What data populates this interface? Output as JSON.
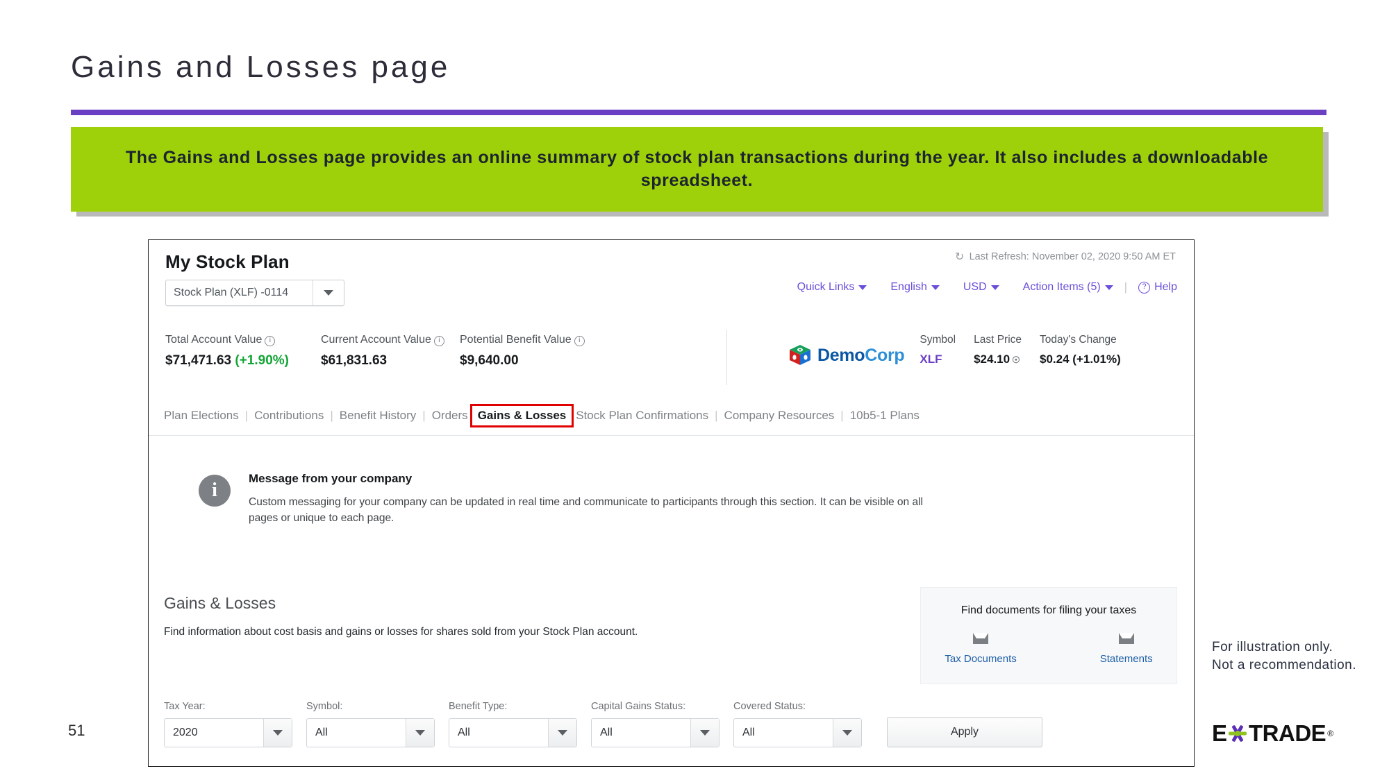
{
  "slide": {
    "title": "Gains and Losses page",
    "page_number": "51",
    "banner_text": "The Gains and Losses page provides an online summary of stock plan transactions during the year. It also includes a downloadable spreadsheet.",
    "footnote": "For illustration only. Not a recommendation.",
    "brand_logo": {
      "e": "E",
      "rest": "TRADE",
      "registered": "®"
    },
    "accent_purple": "#6b3fc4",
    "banner_green": "#9fd10a"
  },
  "app": {
    "title": "My Stock Plan",
    "account_select": {
      "value": "Stock Plan (XLF) -0114"
    },
    "last_refresh": "Last Refresh: November 02, 2020 9:50 AM ET",
    "utility_nav": [
      {
        "label": "Quick Links",
        "has_caret": true
      },
      {
        "label": "English",
        "has_caret": true
      },
      {
        "label": "USD",
        "has_caret": true
      },
      {
        "label": "Action Items (5)",
        "has_caret": true
      },
      {
        "label": "Help",
        "has_caret": false
      }
    ],
    "values": [
      {
        "label": "Total Account Value",
        "amount": "$71,471.63",
        "change": "(+1.90%)"
      },
      {
        "label": "Current Account Value",
        "amount": "$61,831.63",
        "change": ""
      },
      {
        "label": "Potential Benefit Value",
        "amount": "$9,640.00",
        "change": ""
      }
    ],
    "quote": {
      "company": "DemoCorp",
      "company_part1": "Demo",
      "company_part2": "Corp",
      "columns": [
        {
          "header": "Symbol",
          "value": "XLF"
        },
        {
          "header": "Last Price",
          "value": "$24.10"
        },
        {
          "header": "Today's Change",
          "value": "$0.24 (+1.01%)"
        }
      ]
    },
    "tabs": [
      {
        "label": "Plan Elections",
        "selected": false
      },
      {
        "label": "Contributions",
        "selected": false
      },
      {
        "label": "Benefit History",
        "selected": false
      },
      {
        "label": "Orders",
        "selected": false
      },
      {
        "label": "Gains & Losses",
        "selected": true
      },
      {
        "label": "Stock Plan Confirmations",
        "selected": false
      },
      {
        "label": "Company Resources",
        "selected": false
      },
      {
        "label": "10b5-1 Plans",
        "selected": false
      }
    ],
    "message": {
      "title": "Message from your company",
      "body": "Custom messaging for your company can be updated in real time and communicate to participants through this section. It can be visible on all pages or unique to each page."
    },
    "section": {
      "heading": "Gains & Losses",
      "description": "Find information about cost basis and gains or losses for shares sold from your Stock Plan account."
    },
    "tax_card": {
      "title": "Find documents for filing your taxes",
      "links": [
        {
          "label": "Tax Documents",
          "icon": "tray-icon"
        },
        {
          "label": "Statements",
          "icon": "tray-icon"
        }
      ]
    },
    "filters": [
      {
        "label": "Tax Year:",
        "value": "2020"
      },
      {
        "label": "Symbol:",
        "value": "All"
      },
      {
        "label": "Benefit Type:",
        "value": "All"
      },
      {
        "label": "Capital Gains Status:",
        "value": "All"
      },
      {
        "label": "Covered Status:",
        "value": "All"
      }
    ],
    "apply_label": "Apply"
  }
}
